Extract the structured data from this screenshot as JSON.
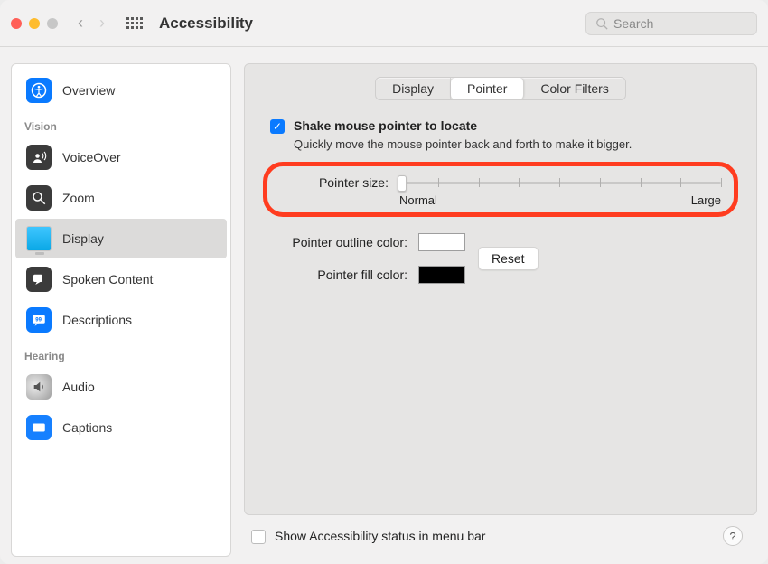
{
  "window": {
    "title": "Accessibility"
  },
  "search": {
    "placeholder": "Search"
  },
  "sidebar": {
    "sections": [
      {
        "label": "",
        "items": [
          {
            "label": "Overview"
          }
        ]
      },
      {
        "label": "Vision",
        "items": [
          {
            "label": "VoiceOver"
          },
          {
            "label": "Zoom"
          },
          {
            "label": "Display",
            "selected": true
          },
          {
            "label": "Spoken Content"
          },
          {
            "label": "Descriptions"
          }
        ]
      },
      {
        "label": "Hearing",
        "items": [
          {
            "label": "Audio"
          },
          {
            "label": "Captions"
          }
        ]
      }
    ]
  },
  "tabs": {
    "items": [
      "Display",
      "Pointer",
      "Color Filters"
    ],
    "active": 1
  },
  "shake": {
    "label": "Shake mouse pointer to locate",
    "helper": "Quickly move the mouse pointer back and forth to make it bigger.",
    "checked": true
  },
  "pointer_size": {
    "label": "Pointer size:",
    "min_label": "Normal",
    "max_label": "Large",
    "value": 0,
    "ticks": 9
  },
  "outline_color": {
    "label": "Pointer outline color:",
    "value": "#ffffff"
  },
  "fill_color": {
    "label": "Pointer fill color:",
    "value": "#000000"
  },
  "reset": {
    "label": "Reset"
  },
  "footer": {
    "menubar_label": "Show Accessibility status in menu bar",
    "menubar_checked": false
  },
  "help": {
    "label": "?"
  }
}
